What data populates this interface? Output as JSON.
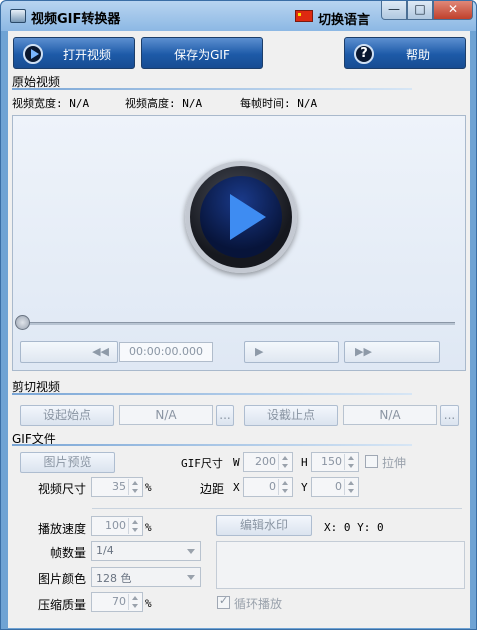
{
  "window": {
    "title": "视频GIF转换器",
    "lang_label": "切换语言",
    "min": "—",
    "max": "□",
    "close": "✕"
  },
  "toolbar": {
    "open_label": "打开视频",
    "save_gif_label": "保存为GIF",
    "help_label": "帮助",
    "help_glyph": "?"
  },
  "source": {
    "section_title": "原始视频",
    "width_label": "视频宽度: N/A",
    "height_label": "视频高度: N/A",
    "frame_time_label": "每帧时间: N/A",
    "time_display": "00:00:00.000",
    "rewind_glyph": "◀◀",
    "play_glyph": "▶",
    "forward_glyph": "▶▶"
  },
  "cut": {
    "section_title": "剪切视频",
    "set_start_label": "设起始点",
    "start_value": "N/A",
    "set_end_label": "设截止点",
    "end_value": "N/A",
    "browse_glyph": "..."
  },
  "gif": {
    "section_title": "GIF文件",
    "preview_label": "图片预览",
    "gif_size_label": "GIF尺寸",
    "w_label": "W",
    "w_value": "200",
    "h_label": "H",
    "h_value": "150",
    "stretch_label": "拉伸",
    "video_size_label": "视频尺寸",
    "video_size_value": "35",
    "percent": "%",
    "margin_label": "边距",
    "x_label": "X",
    "x_value": "0",
    "y_label": "Y",
    "y_value": "0",
    "speed_label": "播放速度",
    "speed_value": "100",
    "frames_label": "帧数量",
    "frames_value": "1/4",
    "color_label": "图片颜色",
    "color_value": "128 色",
    "quality_label": "压缩质量",
    "quality_value": "70",
    "watermark_label": "编辑水印",
    "watermark_coords": "X: 0  Y: 0",
    "loop_label": "循环播放",
    "loop_checked": true
  },
  "colors": {
    "accent": "#1d5aa8",
    "title_bar": "#8cb8e4",
    "background": "#f0f0f0"
  },
  "icons": [
    "app-icon",
    "china-flag-icon",
    "play-circle-icon",
    "help-circle-icon",
    "big-play-icon",
    "rewind-icon",
    "play-icon",
    "fast-forward-icon"
  ]
}
